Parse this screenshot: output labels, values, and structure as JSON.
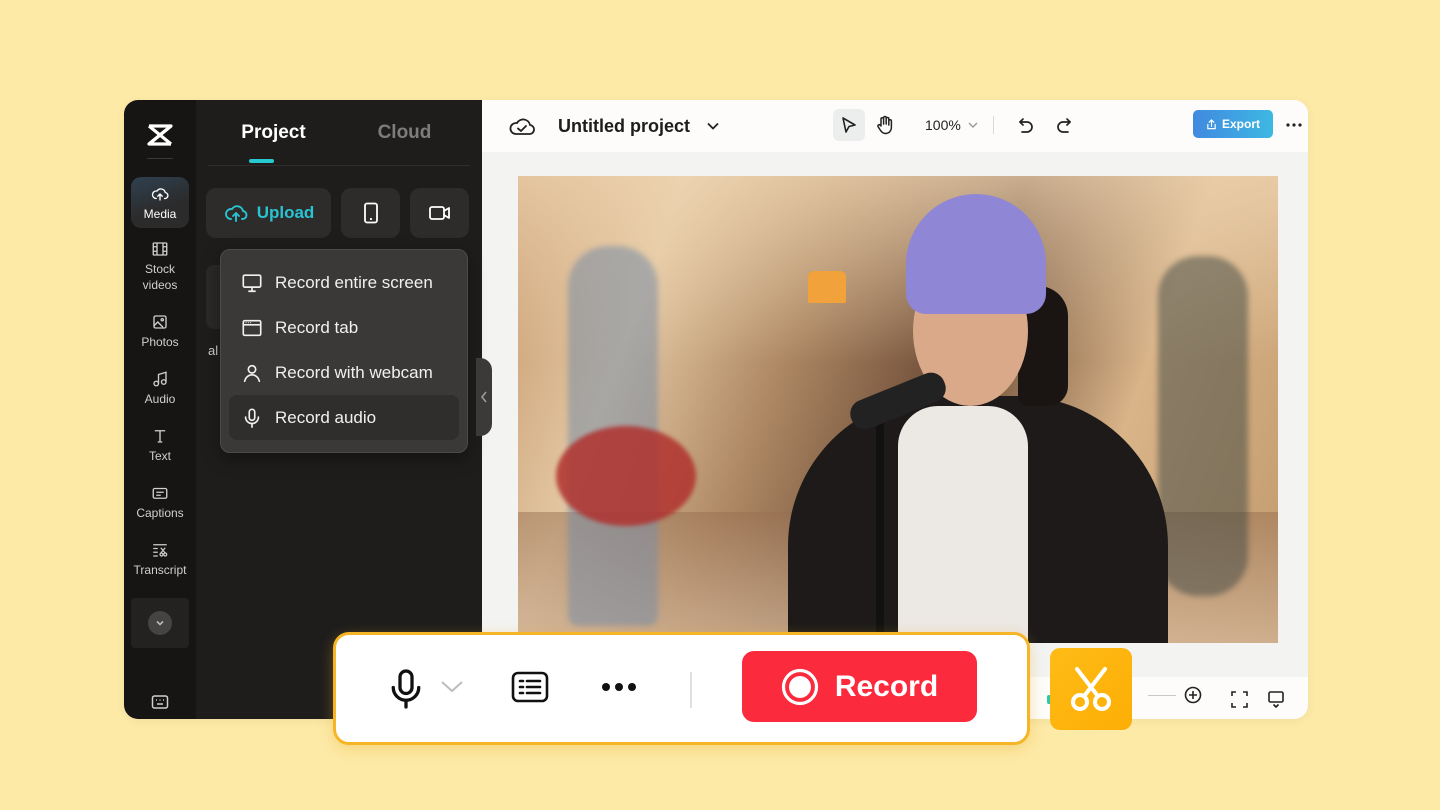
{
  "rail": {
    "logo": "capcut-logo-icon",
    "items": [
      {
        "label": "Media",
        "icon": "cloud-upload-icon",
        "active": true
      },
      {
        "label": "Stock\nvideos",
        "icon": "film-icon"
      },
      {
        "label": "Photos",
        "icon": "image-icon"
      },
      {
        "label": "Audio",
        "icon": "music-note-icon"
      },
      {
        "label": "Text",
        "icon": "text-icon"
      },
      {
        "label": "Captions",
        "icon": "captions-icon"
      },
      {
        "label": "Transcript",
        "icon": "transcript-icon"
      }
    ],
    "more_icon": "chevron-down-icon",
    "bottom_icon": "keyboard-icon"
  },
  "panel": {
    "tabs": [
      {
        "label": "Project",
        "active": true
      },
      {
        "label": "Cloud",
        "active": false
      }
    ],
    "upload_label": "Upload",
    "phone_icon": "phone-icon",
    "record_icon": "video-camera-icon",
    "ghost_text": "al",
    "dropdown": [
      {
        "label": "Record entire screen",
        "icon": "monitor-icon"
      },
      {
        "label": "Record tab",
        "icon": "browser-tab-icon"
      },
      {
        "label": "Record with webcam",
        "icon": "person-icon"
      },
      {
        "label": "Record audio",
        "icon": "microphone-icon",
        "hover": true
      }
    ]
  },
  "topbar": {
    "project_title": "Untitled project",
    "zoom_level": "100%",
    "export_label": "Export"
  },
  "canvas": {
    "description": "Photo of a woman in purple beanie singing into a microphone with a band behind her"
  },
  "record_bar": {
    "record_label": "Record"
  },
  "colors": {
    "background": "#fdeaa7",
    "accent_teal": "#27c9d0",
    "record_red": "#fb2b3d",
    "highlight_yellow": "#f5b527",
    "export_blue": "#4189e0"
  }
}
